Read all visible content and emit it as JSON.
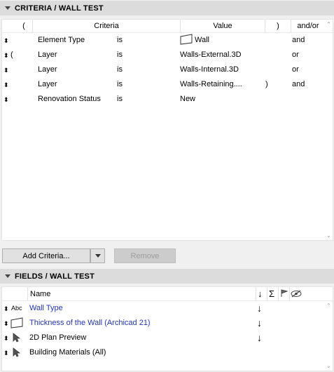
{
  "criteria_section": {
    "title": "CRITERIA /  WALL TEST",
    "columns": {
      "open_paren": "(",
      "criteria": "Criteria",
      "value": "Value",
      "close_paren": ")",
      "andor": "and/or"
    },
    "rows": [
      {
        "open": "",
        "criteria": "Element Type",
        "op": "is",
        "value": "Wall",
        "close": "",
        "andor": "and"
      },
      {
        "open": "(",
        "criteria": "Layer",
        "op": "is",
        "value": "Walls-External.3D",
        "close": "",
        "andor": "or"
      },
      {
        "open": "",
        "criteria": "Layer",
        "op": "is",
        "value": "Walls-Internal.3D",
        "close": "",
        "andor": "or"
      },
      {
        "open": "",
        "criteria": "Layer",
        "op": "is",
        "value": "Walls-Retaining....",
        "close": ")",
        "andor": "and"
      },
      {
        "open": "",
        "criteria": "Renovation Status",
        "op": "is",
        "value": "New",
        "close": "",
        "andor": ""
      }
    ],
    "add_button": "Add Criteria...",
    "remove_button": "Remove"
  },
  "fields_section": {
    "title": "FIELDS /  WALL TEST",
    "name_header": "Name",
    "sort_header_icon": "sort-arrow-icon",
    "sum_header": "Σ",
    "rows": [
      {
        "icon": "abc-text-icon",
        "icon_text": "Abc",
        "name": "Wall Type",
        "sorted": "↓",
        "color": "#2233bb"
      },
      {
        "icon": "wall-shape-icon",
        "icon_text": "",
        "name": "Thickness of the Wall (Archicad 21)",
        "sorted": "↓",
        "color": "#2233bb"
      },
      {
        "icon": "cursor-arrow-icon",
        "icon_text": "",
        "name": "2D Plan Preview",
        "sorted": "↓",
        "color": "#000000"
      },
      {
        "icon": "cursor-arrow-icon",
        "icon_text": "",
        "name": "Building Materials (All)",
        "sorted": "",
        "color": "#000000"
      }
    ]
  }
}
